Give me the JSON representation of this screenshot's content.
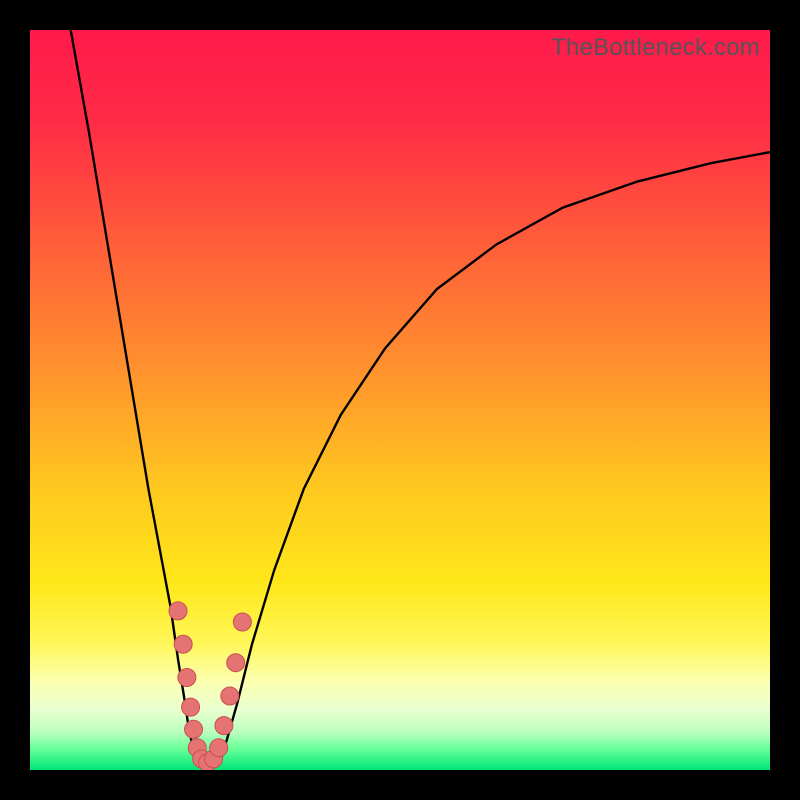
{
  "watermark": "TheBottleneck.com",
  "colors": {
    "black": "#000000",
    "curve": "#000000",
    "marker_fill": "#e57373",
    "marker_stroke": "#c94f4f",
    "bottom_band": "#00e676"
  },
  "gradient_stops": [
    {
      "pct": 0,
      "color": "#ff1a4b"
    },
    {
      "pct": 12,
      "color": "#ff2a46"
    },
    {
      "pct": 28,
      "color": "#ff5b3a"
    },
    {
      "pct": 45,
      "color": "#ff8f2e"
    },
    {
      "pct": 62,
      "color": "#ffc81f"
    },
    {
      "pct": 75,
      "color": "#ffe81a"
    },
    {
      "pct": 83,
      "color": "#fff75a"
    },
    {
      "pct": 88,
      "color": "#fcffb0"
    },
    {
      "pct": 92,
      "color": "#e8ffd0"
    },
    {
      "pct": 95,
      "color": "#b7ffbd"
    },
    {
      "pct": 97,
      "color": "#6dff9a"
    },
    {
      "pct": 100,
      "color": "#00e676"
    }
  ],
  "chart_data": {
    "type": "line",
    "title": "",
    "xlabel": "",
    "ylabel": "",
    "xlim": [
      0,
      100
    ],
    "ylim": [
      0,
      100
    ],
    "series": [
      {
        "name": "left-branch",
        "x": [
          5.5,
          8,
          10,
          12,
          14,
          16,
          17.5,
          19,
          20,
          20.8,
          21.4,
          22,
          22.5
        ],
        "y": [
          100,
          86,
          74,
          62,
          50,
          38,
          30,
          22,
          15,
          10,
          6,
          3,
          1
        ]
      },
      {
        "name": "valley-floor",
        "x": [
          22.5,
          23,
          23.5,
          24,
          24.5,
          25,
          25.5,
          26
        ],
        "y": [
          1,
          0.5,
          0.3,
          0.25,
          0.3,
          0.5,
          1,
          2
        ]
      },
      {
        "name": "right-branch",
        "x": [
          26,
          28,
          30,
          33,
          37,
          42,
          48,
          55,
          63,
          72,
          82,
          92,
          100
        ],
        "y": [
          2,
          9,
          17,
          27,
          38,
          48,
          57,
          65,
          71,
          76,
          79.5,
          82,
          83.5
        ]
      }
    ],
    "markers": {
      "name": "highlighted-points",
      "points": [
        {
          "x": 20.0,
          "y": 21.5
        },
        {
          "x": 20.7,
          "y": 17.0
        },
        {
          "x": 21.2,
          "y": 12.5
        },
        {
          "x": 21.7,
          "y": 8.5
        },
        {
          "x": 22.1,
          "y": 5.5
        },
        {
          "x": 22.6,
          "y": 3.0
        },
        {
          "x": 23.2,
          "y": 1.5
        },
        {
          "x": 24.0,
          "y": 1.0
        },
        {
          "x": 24.8,
          "y": 1.5
        },
        {
          "x": 25.5,
          "y": 3.0
        },
        {
          "x": 26.2,
          "y": 6.0
        },
        {
          "x": 27.0,
          "y": 10.0
        },
        {
          "x": 27.8,
          "y": 14.5
        },
        {
          "x": 28.7,
          "y": 20.0
        }
      ]
    }
  }
}
